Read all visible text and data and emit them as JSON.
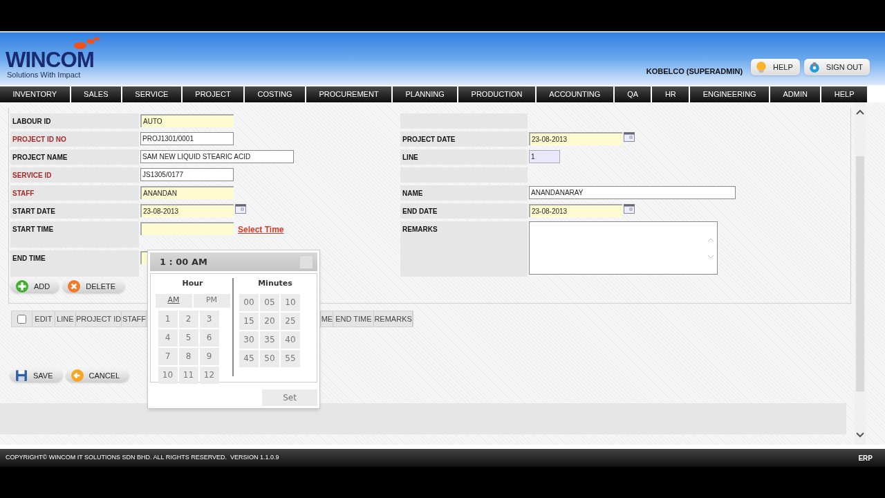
{
  "header": {
    "logo": "WINCOM",
    "tagline": "Solutions With Impact",
    "user": "KOBELCO (SUPERADMIN)",
    "buttons": [
      {
        "label": "HELP",
        "kind": "help"
      },
      {
        "label": "SIGN OUT",
        "kind": "signout"
      }
    ]
  },
  "nav": [
    "INVENTORY",
    "SALES",
    "SERVICE",
    "PROJECT",
    "COSTING",
    "PROCUREMENT",
    "PLANNING",
    "PRODUCTION",
    "ACCOUNTING",
    "QA",
    "HR",
    "ENGINEERING",
    "ADMIN",
    "HELP"
  ],
  "form_left": [
    {
      "label": "LABOUR ID",
      "required": false,
      "field": {
        "value": "AUTO",
        "kind": "highlighted"
      }
    },
    {
      "label": "PROJECT ID NO",
      "required": true,
      "field": {
        "value": "PROJ1301/0001",
        "kind": "plain"
      }
    },
    {
      "label": "PROJECT NAME",
      "required": false,
      "field": {
        "value": "SAM NEW LIQUID STEARIC ACID",
        "kind": "plain",
        "wide": true
      }
    },
    {
      "label": "SERVICE ID",
      "required": true,
      "field": {
        "value": "JS1305/0177",
        "kind": "plain"
      }
    },
    {
      "label": "STAFF",
      "required": true,
      "field": {
        "value": "ANANDAN",
        "kind": "highlighted"
      }
    },
    {
      "label": "START DATE",
      "required": false,
      "field": {
        "value": "23-08-2013",
        "kind": "highlighted"
      },
      "calendar": true
    },
    {
      "label": "START TIME",
      "required": false,
      "field": {
        "kind": "highlighted"
      },
      "link": "Select Time",
      "tall": true
    },
    {
      "label": "END TIME",
      "required": false,
      "field": {
        "kind": "highlighted"
      },
      "tall": true
    }
  ],
  "form_right": [
    {
      "kind": "blank"
    },
    {
      "kind": "row",
      "label": "PROJECT DATE",
      "field": {
        "value": "23-08-2013",
        "kind": "highlighted"
      },
      "calendar": true
    },
    {
      "kind": "row",
      "label": "LINE",
      "field": {
        "value": "1",
        "kind": "number"
      }
    },
    {
      "kind": "blank"
    },
    {
      "kind": "row",
      "label": "NAME",
      "field": {
        "value": "ANANDANARAY",
        "kind": "plain",
        "wide": true
      }
    },
    {
      "kind": "row",
      "label": "END DATE",
      "field": {
        "value": "23-08-2013",
        "kind": "highlighted"
      },
      "calendar": true
    },
    {
      "kind": "remarks",
      "label": "REMARKS"
    }
  ],
  "line_buttons": [
    {
      "label": "ADD",
      "kind": "add"
    },
    {
      "label": "DELETE",
      "kind": "delete"
    }
  ],
  "table": {
    "checked": false,
    "columns": [
      "EDIT",
      "LINE",
      "PROJECT ID",
      "STAFF",
      "ME",
      "END TIME",
      "REMARKS"
    ]
  },
  "form_buttons": [
    {
      "label": "SAVE",
      "kind": "save"
    },
    {
      "label": "CANCEL",
      "kind": "cancel"
    }
  ],
  "time_picker": {
    "display": "1 : 00 AM",
    "hour_title": "Hour",
    "minutes_title": "Minutes",
    "periods": [
      {
        "label": "AM",
        "selected": true
      },
      {
        "label": "PM",
        "selected": false
      }
    ],
    "hours": [
      "1",
      "2",
      "3",
      "4",
      "5",
      "6",
      "7",
      "8",
      "9",
      "10",
      "11",
      "12"
    ],
    "minutes": [
      "00",
      "05",
      "10",
      "15",
      "20",
      "25",
      "30",
      "35",
      "40",
      "45",
      "50",
      "55"
    ],
    "set": "Set"
  },
  "footer": {
    "copyright": "COPYRIGHT© WINCOM IT SOLUTIONS SDN BHD. ALL RIGHTS RESERVED.  VERSION 1.1.0.9",
    "app": "ERP"
  }
}
